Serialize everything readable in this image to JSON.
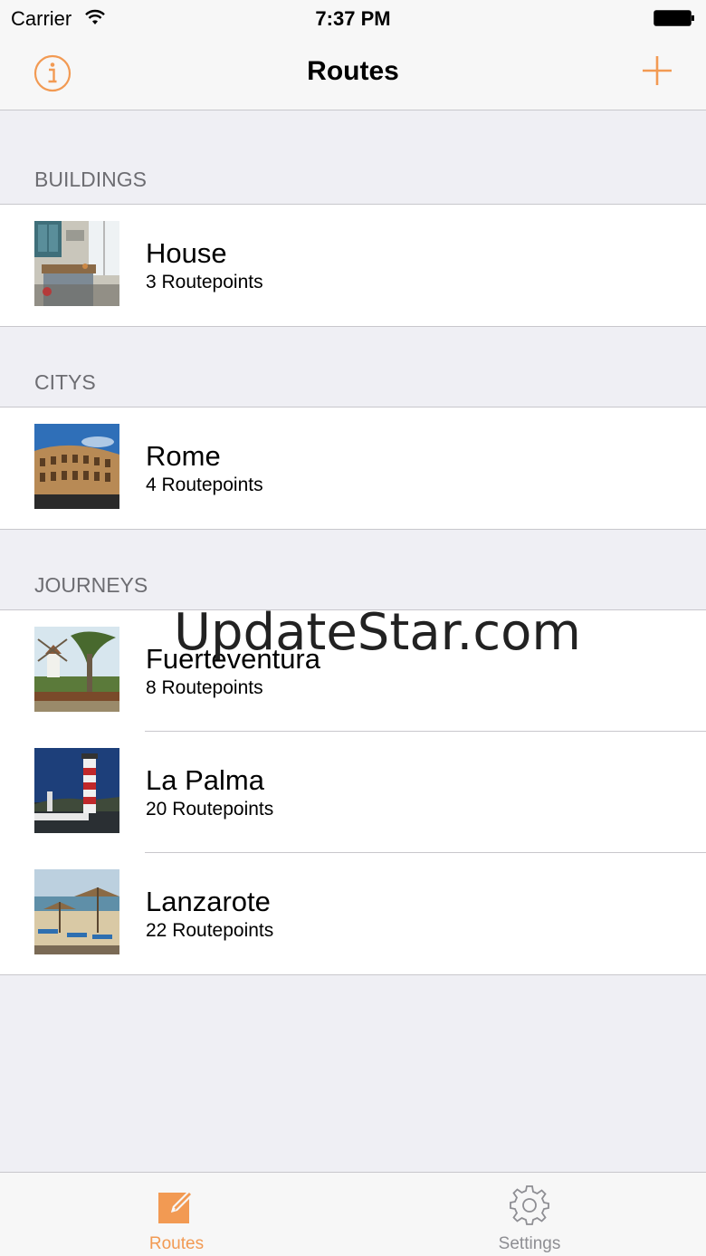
{
  "status_bar": {
    "carrier": "Carrier",
    "time": "7:37 PM"
  },
  "nav": {
    "title": "Routes",
    "info_icon": "info-circle-icon",
    "add_icon": "plus-icon",
    "accent_color": "#f29a53"
  },
  "sections": [
    {
      "header": "BUILDINGS",
      "rows": [
        {
          "name": "House",
          "subtitle": "3 Routepoints",
          "thumb": "kitchen-photo"
        }
      ]
    },
    {
      "header": "CITYS",
      "rows": [
        {
          "name": "Rome",
          "subtitle": "4 Routepoints",
          "thumb": "colosseum-photo"
        }
      ]
    },
    {
      "header": "JOURNEYS",
      "rows": [
        {
          "name": "Fuerteventura",
          "subtitle": "8 Routepoints",
          "thumb": "windmill-photo"
        },
        {
          "name": "La Palma",
          "subtitle": "20 Routepoints",
          "thumb": "lighthouse-photo"
        },
        {
          "name": "Lanzarote",
          "subtitle": "22 Routepoints",
          "thumb": "beach-photo"
        }
      ]
    }
  ],
  "watermark": "UpdateStar.com",
  "tabs": [
    {
      "label": "Routes",
      "icon": "edit-icon",
      "selected": true
    },
    {
      "label": "Settings",
      "icon": "gear-icon",
      "selected": false
    }
  ]
}
